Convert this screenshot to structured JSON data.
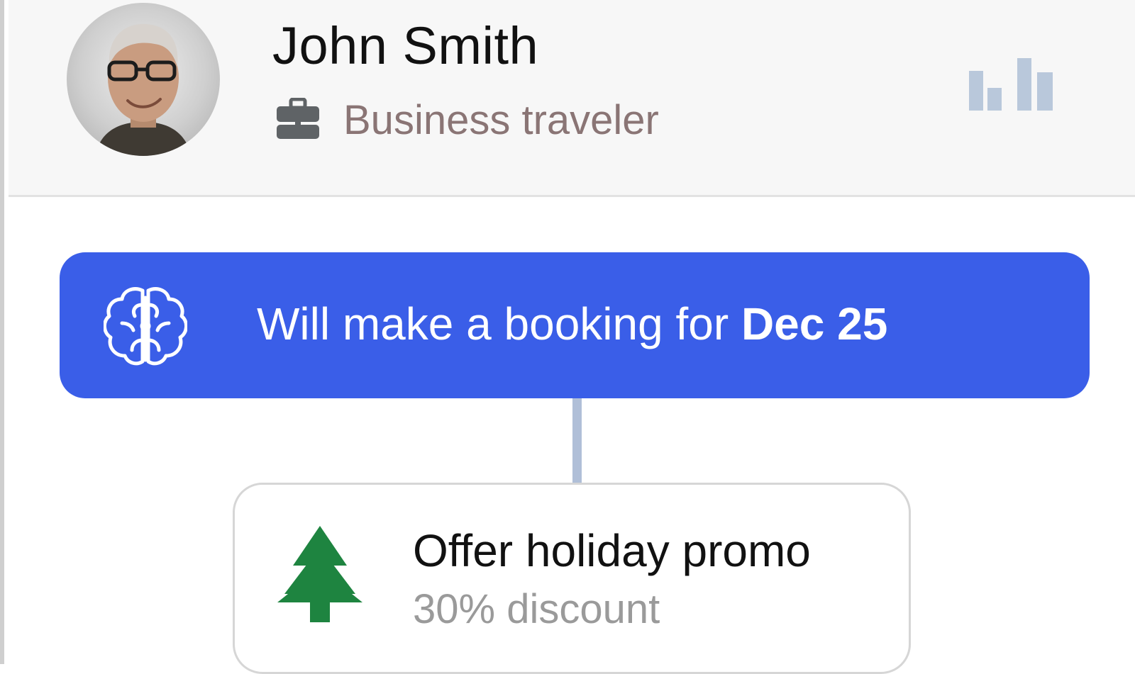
{
  "profile": {
    "name": "John Smith",
    "role": "Business traveler",
    "avatar_icon": "person-avatar",
    "role_icon": "briefcase-icon",
    "stats_icon": "bar-chart-icon"
  },
  "insight": {
    "prefix": "Will make a booking for ",
    "highlight": "Dec 25",
    "icon": "brain-icon",
    "background_color": "#3a5ee8"
  },
  "action": {
    "title": "Offer holiday promo",
    "subtitle": "30% discount",
    "icon": "tree-icon",
    "icon_color": "#1e8440"
  },
  "colors": {
    "accent": "#3a5ee8",
    "connector": "#b0bfd8",
    "stats_icon": "#b9c8db",
    "role_text": "#8a7575"
  }
}
